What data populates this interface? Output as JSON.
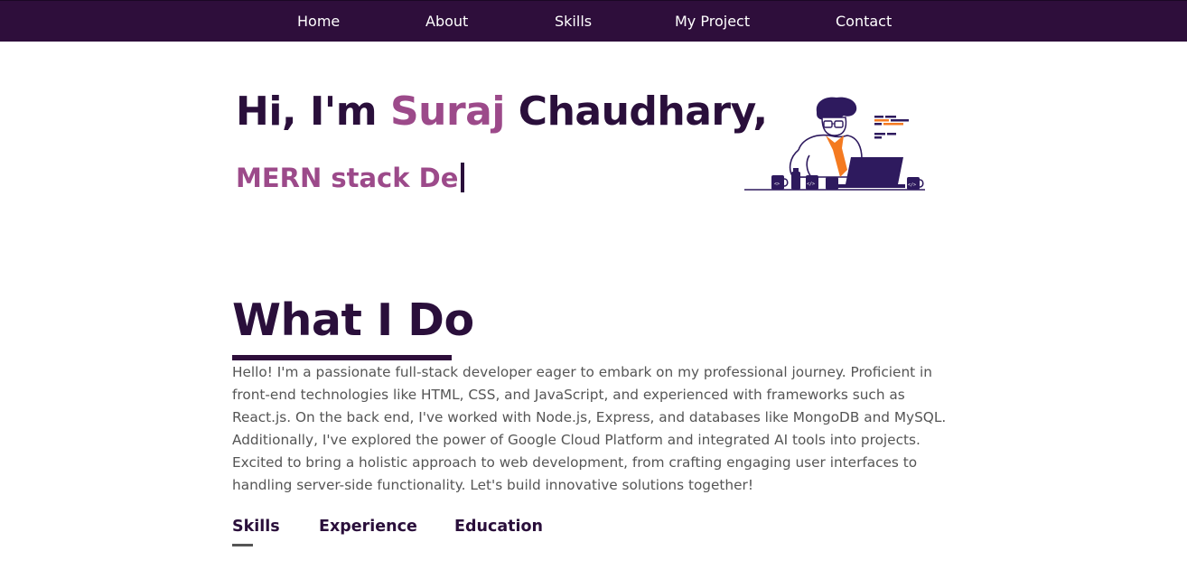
{
  "nav": {
    "items": [
      {
        "label": "Home"
      },
      {
        "label": "About"
      },
      {
        "label": "Skills"
      },
      {
        "label": "My Project"
      },
      {
        "label": "Contact"
      }
    ]
  },
  "hero": {
    "greeting": "Hi, I'm ",
    "first_name": "Suraj",
    "last_name": " Chaudhary,",
    "typed_text": "MERN stack De",
    "accent_color": "#9c4a8a",
    "illustration_icon": "developer-at-laptop-illustration"
  },
  "about": {
    "title": "What I Do",
    "paragraph": "Hello! I'm a passionate full-stack developer eager to embark on my professional journey. Proficient in front-end technologies like HTML, CSS, and JavaScript, and experienced with frameworks such as React.js. On the back end, I've worked with Node.js, Express, and databases like MongoDB and MySQL. Additionally, I've explored the power of Google Cloud Platform and integrated AI tools into projects. Excited to bring a holistic approach to web development, from crafting engaging user interfaces to handling server-side functionality. Let's build innovative solutions together!",
    "tabs": [
      {
        "label": "Skills",
        "active": true
      },
      {
        "label": "Experience",
        "active": false
      },
      {
        "label": "Education",
        "active": false
      }
    ]
  },
  "theme": {
    "navbar_bg": "#2e0e3b",
    "primary_text": "#2a0f3b",
    "body_text": "#555555"
  }
}
